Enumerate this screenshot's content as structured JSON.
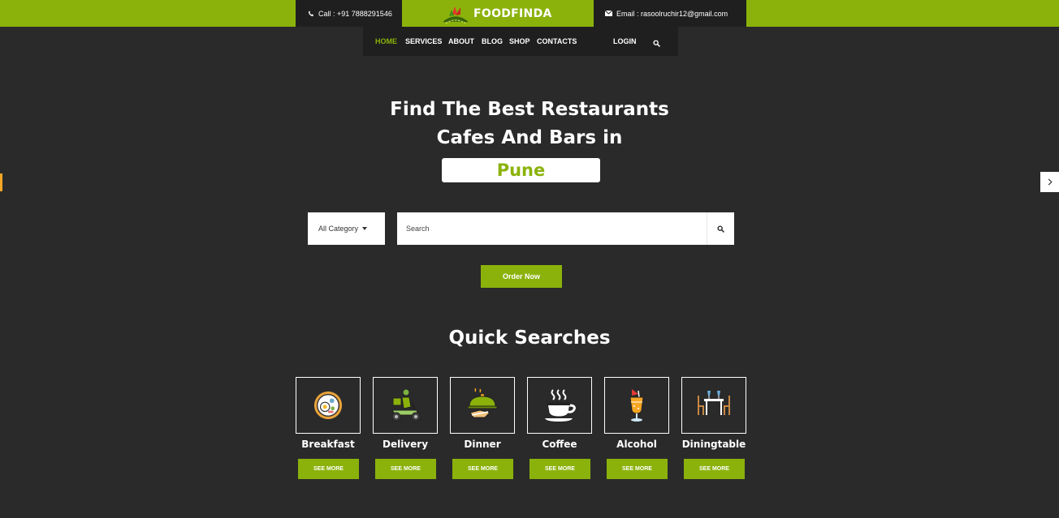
{
  "topbar": {
    "call": "Call : +91 7888291546",
    "brand": "FOODFINDA",
    "email": "Email : rasoolruchir12@gmail.com"
  },
  "nav": {
    "items": [
      "HOME",
      "SERVICES",
      "ABOUT",
      "BLOG",
      "SHOP",
      "CONTACTS"
    ],
    "login": "LOGIN"
  },
  "hero": {
    "line1": "Find The Best Restaurants",
    "line2": "Cafes And Bars in",
    "city": "Pune"
  },
  "search": {
    "category": "All Category",
    "placeholder": "Search"
  },
  "order_label": "Order Now",
  "quick": {
    "title": "Quick Searches",
    "items": [
      {
        "label": "Breakfast",
        "button": "SEE MORE",
        "icon": "breakfast-icon"
      },
      {
        "label": "Delivery",
        "button": "SEE MORE",
        "icon": "delivery-scooter-icon"
      },
      {
        "label": "Dinner",
        "button": "SEE MORE",
        "icon": "dinner-cloche-icon"
      },
      {
        "label": "Coffee",
        "button": "SEE MORE",
        "icon": "coffee-cup-icon"
      },
      {
        "label": "Alcohol",
        "button": "SEE MORE",
        "icon": "cocktail-icon"
      },
      {
        "label": "Diningtable",
        "button": "SEE MORE",
        "icon": "dining-table-icon"
      }
    ]
  },
  "colors": {
    "accent": "#8bb20b",
    "background": "#2a2a2a",
    "dark_panel": "#1f1f1f",
    "side_marker": "#f5a623"
  }
}
